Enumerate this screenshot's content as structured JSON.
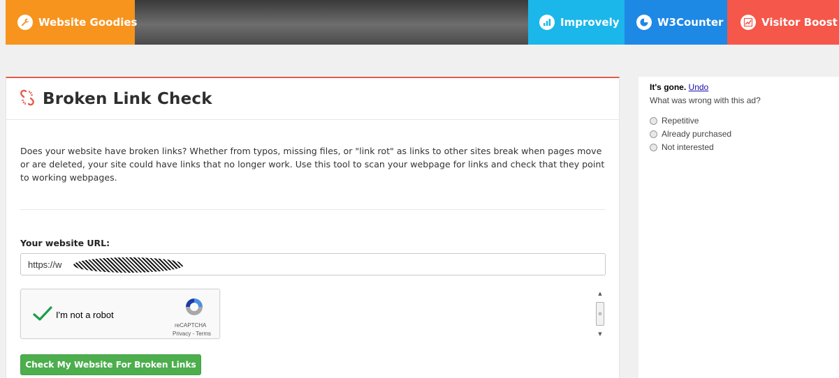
{
  "topbar": {
    "goodies": "Website Goodies",
    "improvely": "Improvely",
    "w3counter": "W3Counter",
    "visitor_boost": "Visitor Boost"
  },
  "card": {
    "title": "Broken Link Check",
    "description": "Does your website have broken links? Whether from typos, missing files, or \"link rot\" as links to other sites break when pages move or are deleted, your site could have links that no longer work. Use this tool to scan your webpage for links and check that they point to working webpages.",
    "url_label": "Your website URL:",
    "url_value": "https://w",
    "captcha_label": "I'm not a robot",
    "captcha_brand": "reCAPTCHA",
    "captcha_links": "Privacy - Terms",
    "submit_label": "Check My Website For Broken Links"
  },
  "ad_feedback": {
    "gone": "It's gone.",
    "undo": "Undo",
    "question": "What was wrong with this ad?",
    "options": [
      "Repetitive",
      "Already purchased",
      "Not interested"
    ]
  },
  "colors": {
    "goodies": "#f7941d",
    "improvely": "#1bb7ea",
    "w3counter": "#1e88e5",
    "visitor_boost": "#f5574a",
    "accent": "#e55a4b",
    "button": "#4cae4c"
  }
}
